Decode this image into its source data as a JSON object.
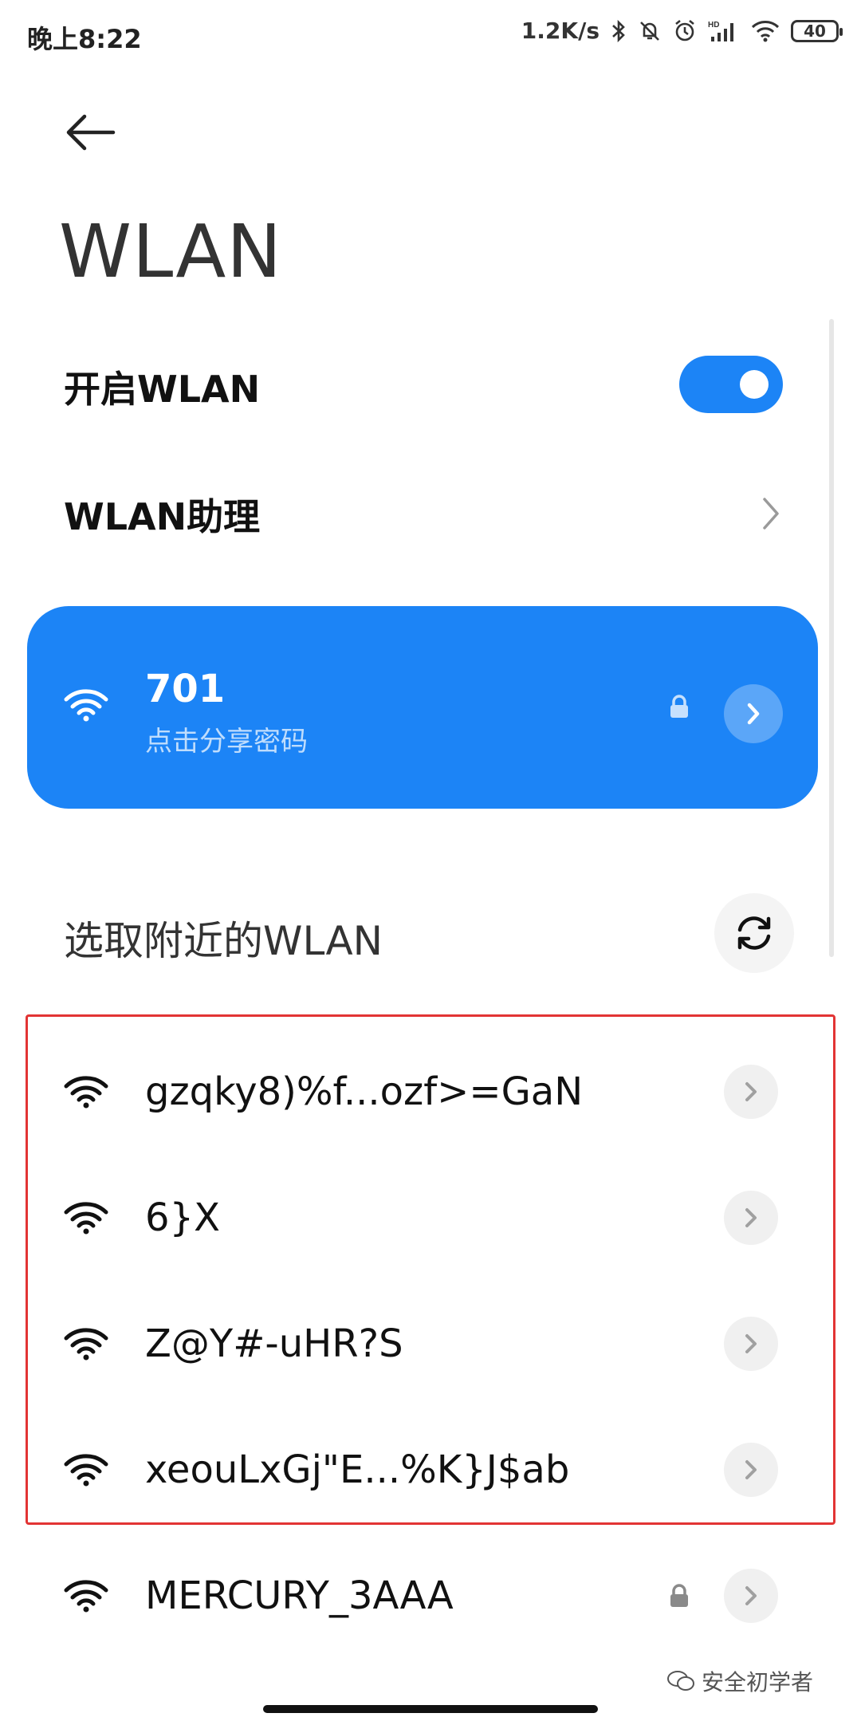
{
  "status_bar": {
    "time": "晚上8:22",
    "speed": "1.2K/s",
    "battery": "40",
    "icons": [
      "bluetooth-icon",
      "mute-bell-icon",
      "alarm-icon",
      "hd-signal-icon",
      "wifi-icon",
      "battery-icon"
    ]
  },
  "header": {
    "back_icon": "back-arrow-icon",
    "title": "WLAN"
  },
  "settings": {
    "enable_wlan_label": "开启WLAN",
    "enable_wlan_on": true,
    "assistant_label": "WLAN助理"
  },
  "connected": {
    "ssid": "701",
    "subtitle": "点击分享密码",
    "locked": true
  },
  "nearby": {
    "title": "选取附近的WLAN",
    "refresh_icon": "refresh-icon",
    "networks": [
      {
        "name": "gzqky8)%f...ozf>=GaN",
        "locked": false
      },
      {
        "name": "6}X",
        "locked": false
      },
      {
        "name": "Z@Y#-uHR?S",
        "locked": false
      },
      {
        "name": " xeouLxGj\"E...%K}J$ab",
        "locked": false
      },
      {
        "name": "MERCURY_3AAA",
        "locked": true
      }
    ]
  },
  "watermark": "安全初学者",
  "colors": {
    "accent": "#1c84f6",
    "highlight_border": "#e23434"
  }
}
